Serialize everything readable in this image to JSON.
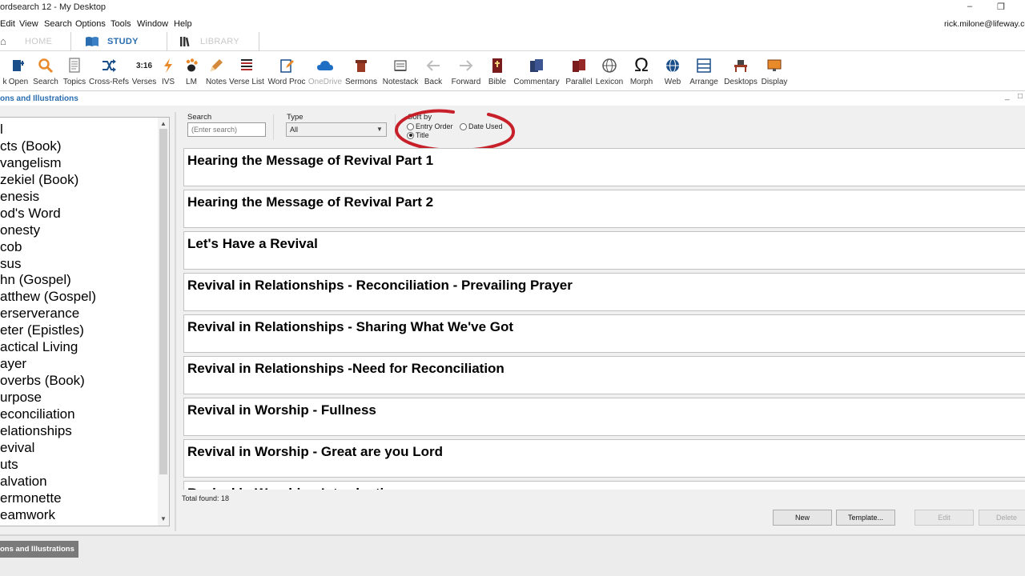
{
  "window": {
    "title": "ordsearch 12 - My Desktop",
    "minimize_glyph": "–",
    "restore_glyph": "❐"
  },
  "menu": {
    "items": [
      "Edit",
      "View",
      "Search",
      "Options",
      "Tools",
      "Window",
      "Help"
    ],
    "account": "rick.milone@lifeway.co"
  },
  "tabs": {
    "home": "HOME",
    "study": "STUDY",
    "library": "LIBRARY",
    "active": "STUDY"
  },
  "toolbar": {
    "items": [
      {
        "label": "k",
        "icon": "link-icon"
      },
      {
        "label": "Open",
        "icon": "open-book-icon"
      },
      {
        "label": "Search",
        "icon": "search-icon"
      },
      {
        "label": "Topics",
        "icon": "topics-icon"
      },
      {
        "label": "Cross-Refs",
        "icon": "shuffle-icon"
      },
      {
        "label": "Verses",
        "icon": "verses-icon",
        "glyph": "3:16"
      },
      {
        "label": "IVS",
        "icon": "lightning-icon"
      },
      {
        "label": "LM",
        "icon": "paw-icon"
      },
      {
        "label": "Notes",
        "icon": "pencil-icon"
      },
      {
        "label": "Verse List",
        "icon": "list-icon"
      },
      {
        "label": "Word Proc",
        "icon": "document-edit-icon"
      },
      {
        "label": "OneDrive",
        "icon": "cloud-icon",
        "disabled": true
      },
      {
        "label": "Sermons",
        "icon": "podium-icon"
      },
      {
        "label": "Notestack",
        "icon": "notestack-icon"
      },
      {
        "label": "Back",
        "icon": "arrow-left-icon",
        "disabled_look": true
      },
      {
        "label": "Forward",
        "icon": "arrow-right-icon",
        "disabled_look": true
      },
      {
        "label": "Bible",
        "icon": "bible-icon"
      },
      {
        "label": "Commentary",
        "icon": "commentary-icon"
      },
      {
        "label": "Parallel",
        "icon": "parallel-books-icon"
      },
      {
        "label": "Lexicon",
        "icon": "globe-lexicon-icon"
      },
      {
        "label": "Morph",
        "icon": "omega-icon",
        "glyph": "Ω"
      },
      {
        "label": "Web",
        "icon": "web-globe-icon"
      },
      {
        "label": "Arrange",
        "icon": "arrange-icon"
      },
      {
        "label": "Desktops",
        "icon": "desktops-icon"
      },
      {
        "label": "Display",
        "icon": "display-icon"
      }
    ]
  },
  "panel": {
    "title": "ons and Illustrations",
    "minimize_glyph": "_",
    "maximize_glyph": "□"
  },
  "topics": {
    "items": [
      "l",
      "cts (Book)",
      "vangelism",
      "zekiel (Book)",
      "enesis",
      "od's Word",
      "onesty",
      "cob",
      "sus",
      "hn (Gospel)",
      "atthew (Gospel)",
      "erserverance",
      "eter (Epistles)",
      "actical Living",
      "ayer",
      "overbs (Book)",
      "urpose",
      "econciliation",
      "elationships",
      "evival",
      "uts",
      "alvation",
      "ermonette",
      "eamwork"
    ]
  },
  "search": {
    "label": "Search",
    "placeholder": "(Enter search)",
    "type_label": "Type",
    "type_value": "All",
    "sort_label": "Sort by",
    "options": [
      {
        "label": "Entry Order",
        "selected": false
      },
      {
        "label": "Date Used",
        "selected": false
      },
      {
        "label": "Title",
        "selected": true
      }
    ]
  },
  "results": {
    "items": [
      "Hearing the Message of Revival Part 1",
      "Hearing the Message of Revival Part 2",
      "Let's Have a Revival",
      "Revival in Relationships - Reconciliation - Prevailing Prayer",
      "Revival in Relationships - Sharing What We've Got",
      "Revival in Relationships -Need for Reconciliation",
      "Revival in Worship - Fullness",
      "Revival in Worship - Great are you Lord",
      "Revival in Worship - Introduction"
    ],
    "total": "Total found: 18"
  },
  "buttons": {
    "new": "New",
    "template": "Template...",
    "edit": "Edit",
    "delete": "Delete"
  },
  "bottom": {
    "tab": "ons and Illustrations"
  },
  "colors": {
    "accent": "#2a6db0",
    "annotation": "#c8202a"
  }
}
